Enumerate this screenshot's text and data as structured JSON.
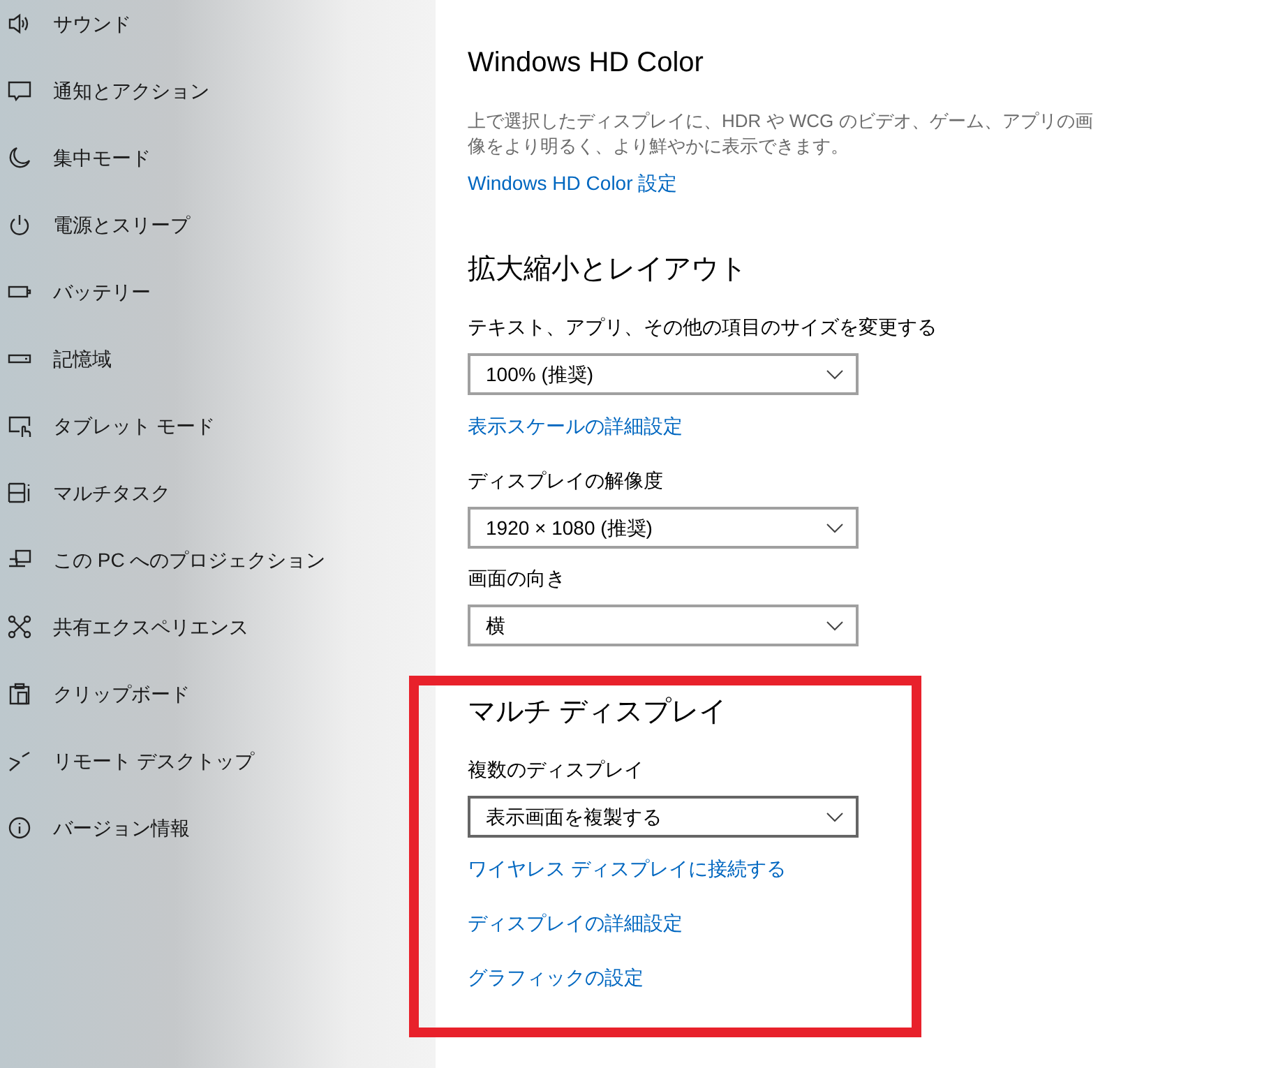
{
  "sidebar": {
    "items": [
      {
        "label": "サウンド"
      },
      {
        "label": "通知とアクション"
      },
      {
        "label": "集中モード"
      },
      {
        "label": "電源とスリープ"
      },
      {
        "label": "バッテリー"
      },
      {
        "label": "記憶域"
      },
      {
        "label": "タブレット モード"
      },
      {
        "label": "マルチタスク"
      },
      {
        "label": "この PC へのプロジェクション"
      },
      {
        "label": "共有エクスペリエンス"
      },
      {
        "label": "クリップボード"
      },
      {
        "label": "リモート デスクトップ"
      },
      {
        "label": "バージョン情報"
      }
    ]
  },
  "sections": [
    {
      "title": "Windows HD Color",
      "highlighted": false,
      "items": [
        {
          "kind": "text",
          "text": "上で選択したディスプレイに、HDR や WCG のビデオ、ゲーム、アプリの画像をより明るく、より鮮やかに表示できます。"
        },
        {
          "kind": "link",
          "text": "Windows HD Color 設定"
        }
      ]
    },
    {
      "title": "拡大縮小とレイアウト",
      "highlighted": false,
      "items": [
        {
          "kind": "dropdown",
          "label": "テキスト、アプリ、その他の項目のサイズを変更する",
          "value": "100% (推奨)",
          "focused": false
        },
        {
          "kind": "link",
          "text": "表示スケールの詳細設定"
        },
        {
          "kind": "dropdown",
          "label": "ディスプレイの解像度",
          "value": "1920 × 1080 (推奨)",
          "focused": false
        },
        {
          "kind": "dropdown",
          "label": "画面の向き",
          "value": "横",
          "focused": false
        }
      ]
    },
    {
      "title": "マルチ ディスプレイ",
      "highlighted": true,
      "items": [
        {
          "kind": "dropdown",
          "label": "複数のディスプレイ",
          "value": "表示画面を複製する",
          "focused": true
        },
        {
          "kind": "link",
          "text": "ワイヤレス ディスプレイに接続する"
        },
        {
          "kind": "link",
          "text": "ディスプレイの詳細設定"
        },
        {
          "kind": "link",
          "text": "グラフィックの設定"
        }
      ]
    }
  ]
}
